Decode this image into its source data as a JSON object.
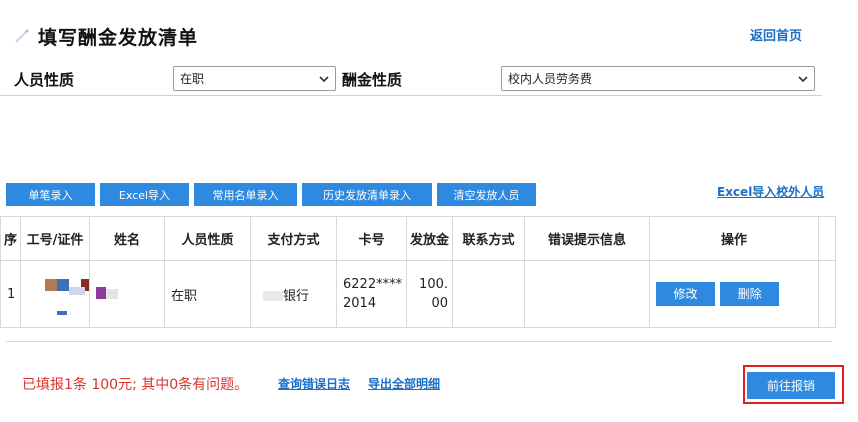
{
  "header": {
    "title": "填写酬金发放清单",
    "back_home": "返回首页"
  },
  "filters": {
    "person_nature_label": "人员性质",
    "person_nature_value": "在职",
    "pay_nature_label": "酬金性质",
    "pay_nature_value": "校内人员劳务费"
  },
  "toolbar": {
    "buttons": [
      "单笔录入",
      "Excel导入",
      "常用名单录入",
      "历史发放清单录入",
      "清空发放人员"
    ],
    "external_import": "Excel导入校外人员"
  },
  "table": {
    "columns": [
      "序",
      "工号/证件",
      "姓名",
      "人员性质",
      "支付方式",
      "卡号",
      "发放金",
      "联系方式",
      "错误提示信息",
      "操作"
    ],
    "rows": [
      {
        "index": "1",
        "person_nature": "在职",
        "payment": "银行",
        "card": "6222**** 2014",
        "amount": "100. 00",
        "contact": "",
        "error": "",
        "edit": "修改",
        "delete": "删除"
      }
    ]
  },
  "footer": {
    "summary": "已填报1条 100元; 其中0条有问题。",
    "query_log": "查询错误日志",
    "export_all": "导出全部明细",
    "submit": "前往报销"
  },
  "colors": {
    "accent": "#2d8ae0",
    "link": "#1a6fc4",
    "error": "#d9342b",
    "highlight_frame": "#e02020"
  }
}
